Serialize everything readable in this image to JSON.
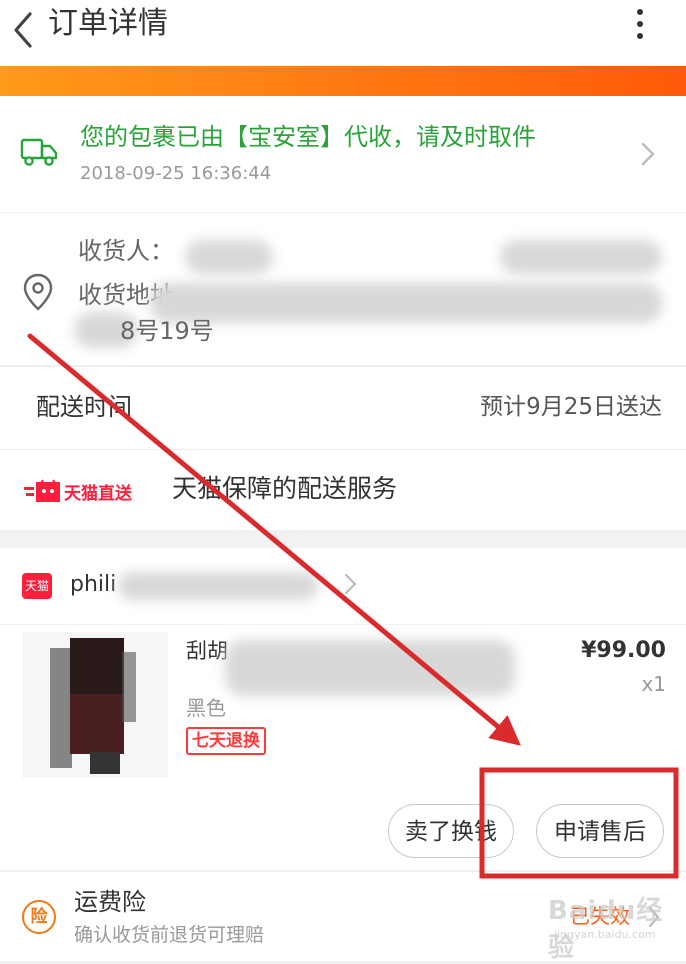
{
  "header": {
    "title": "订单详情",
    "back_icon": "chevron-left-icon",
    "more_icon": "more-vertical-icon"
  },
  "logistics": {
    "status": "您的包裹已由【宝安室】代收，请及时取件",
    "time": "2018-09-25 16:36:44",
    "icon": "truck-icon"
  },
  "address": {
    "receiver_label": "收货人：",
    "address_label": "收货地址",
    "address_tail": "8号19号",
    "icon": "location-pin-icon"
  },
  "delivery": {
    "label": "配送时间",
    "value": "预计9月25日送达"
  },
  "service": {
    "logo_text": "天猫直送",
    "text": "天猫保障的配送服务"
  },
  "store": {
    "icon_text": "天猫",
    "name": "phili"
  },
  "product": {
    "title": "刮胡",
    "variant": "黑色",
    "badge": "七天退换",
    "price": "¥99.00",
    "qty": "x1"
  },
  "actions": {
    "change_label": "卖了换钱",
    "aftersale_label": "申请售后"
  },
  "insurance": {
    "icon_text": "险",
    "title": "运费险",
    "desc": "确认收货前退货可理赔",
    "status": "已失效"
  },
  "watermark": {
    "main": "Baidu经验",
    "sub": "jingyan.baidu.com"
  },
  "colors": {
    "accent_orange": "#ff7a12",
    "status_green": "#2aa43a",
    "tmall_red": "#ff1e3c",
    "annotation_red": "#d92b2b"
  }
}
